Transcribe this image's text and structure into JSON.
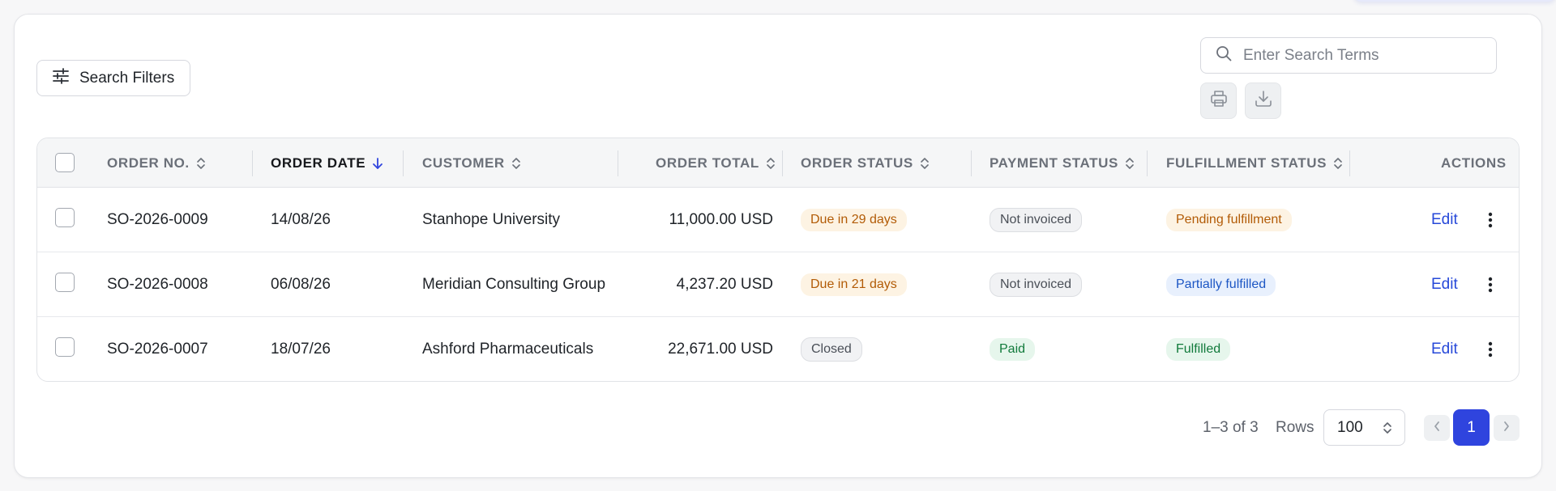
{
  "toolbar": {
    "filters_label": "Search Filters",
    "search_placeholder": "Enter Search Terms"
  },
  "table": {
    "columns": [
      {
        "key": "order_no",
        "label": "ORDER NO."
      },
      {
        "key": "order_date",
        "label": "ORDER DATE"
      },
      {
        "key": "customer",
        "label": "CUSTOMER"
      },
      {
        "key": "order_total",
        "label": "ORDER TOTAL"
      },
      {
        "key": "order_status",
        "label": "ORDER STATUS"
      },
      {
        "key": "payment_status",
        "label": "PAYMENT STATUS"
      },
      {
        "key": "fulfillment_status",
        "label": "FULFILLMENT STATUS"
      },
      {
        "key": "actions",
        "label": "ACTIONS"
      }
    ],
    "sorted_column": "order_date",
    "sort_direction": "descending",
    "rows": [
      {
        "order_no": "SO-2026-0009",
        "order_date": "14/08/26",
        "customer": "Stanhope University",
        "order_total": "11,000.00 USD",
        "order_status": "Due in 29 days",
        "payment_status": "Not invoiced",
        "fulfillment_status": "Pending fulfillment",
        "edit": "Edit"
      },
      {
        "order_no": "SO-2026-0008",
        "order_date": "06/08/26",
        "customer": "Meridian Consulting Group",
        "order_total": "4,237.20 USD",
        "order_status": "Due in 21 days",
        "payment_status": "Not invoiced",
        "fulfillment_status": "Partially fulfilled",
        "edit": "Edit"
      },
      {
        "order_no": "SO-2026-0007",
        "order_date": "18/07/26",
        "customer": "Ashford Pharmaceuticals",
        "order_total": "22,671.00 USD",
        "order_status": "Closed",
        "payment_status": "Paid",
        "fulfillment_status": "Fulfilled",
        "edit": "Edit"
      }
    ]
  },
  "pagination": {
    "range_text": "1–3 of 3",
    "rows_label": "Rows",
    "rows_per_page": "100",
    "current_page": "1"
  },
  "colors": {
    "accent": "#2f44de",
    "link": "#2648d9",
    "warning_text": "#b25b06",
    "success_text": "#117a3b",
    "info_text": "#1c56c4"
  }
}
